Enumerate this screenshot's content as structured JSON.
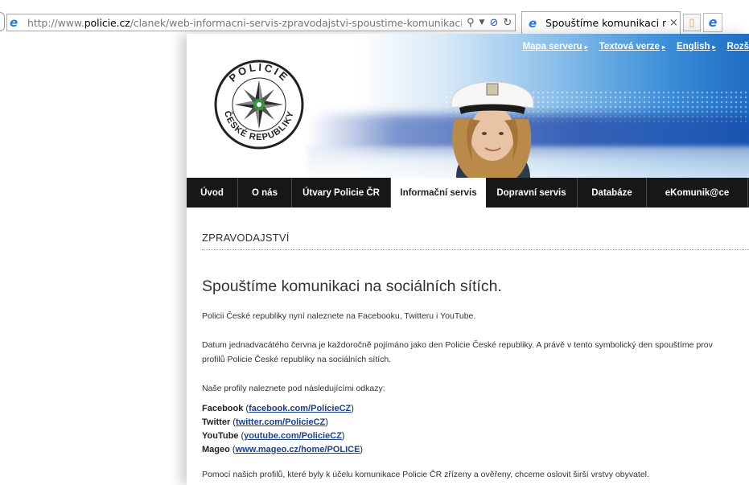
{
  "browser": {
    "url_prefix": "http://www.",
    "url_domain": "policie.cz",
    "url_path": "/clanek/web-informacni-servis-zpravodajstvi-spoustime-komunikaci-na-socialn",
    "tab_title": "Spouštíme komunikaci na s...",
    "tab_close": "×"
  },
  "toplinks": [
    "Mapa serveru",
    "Textová verze",
    "English",
    "Rozš"
  ],
  "logo": {
    "top_text": "POLICIE",
    "bottom_text": "ČESKÉ REPUBLIKY"
  },
  "nav": [
    {
      "label": "Úvod",
      "active": false
    },
    {
      "label": "O nás",
      "active": false
    },
    {
      "label": "Útvary Policie ČR",
      "active": false
    },
    {
      "label": "Informační servis",
      "active": true
    },
    {
      "label": "Dopravní servis",
      "active": false
    },
    {
      "label": "Databáze",
      "active": false
    },
    {
      "label": "eKomunik@ce",
      "active": false
    }
  ],
  "content": {
    "section": "ZPRAVODAJSTVÍ",
    "headline": "Spouštíme komunikaci na sociálních sítích.",
    "p1": "Policii České republiky nyní naleznete na Facebooku, Twitteru i YouTube.",
    "p2a": "Datum jednadvacátého června je každoročně pojímáno jako den Policie České republiky. A právě v tento symbolický den spouštíme prov",
    "p2b": "profilů Policie České republiky na sociálních sítích.",
    "p3": "Naše profily naleznete pod následujícími odkazy:",
    "links": [
      {
        "name": "Facebook",
        "open": " (",
        "url": "facebook.com/PolicieCZ",
        "close": ")"
      },
      {
        "name": "Twitter",
        "open": " (",
        "url": "twitter.com/PolicieCZ",
        "close": ")"
      },
      {
        "name": "YouTube",
        "open": " (",
        "url": "youtube.com/PolicieCZ",
        "close": ")"
      },
      {
        "name": " Mageo",
        "open": " (",
        "url": "www.mageo.cz/home/POLICE",
        "close": ")"
      }
    ],
    "p4": "Pomocí našich profilů, které byly k účelu komunikace Policie ČR zřízeny a ověřeny, chceme oslovit širší vrstvy obyvatel."
  }
}
